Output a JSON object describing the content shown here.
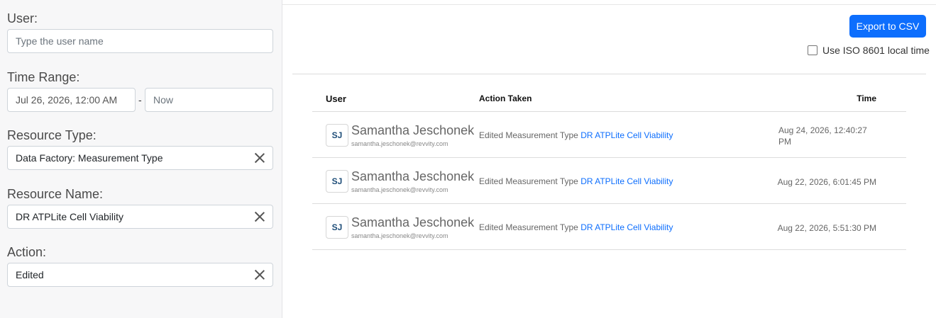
{
  "filters": {
    "user": {
      "label": "User:",
      "placeholder": "Type the user name"
    },
    "time_range": {
      "label": "Time Range:",
      "start": "Jul 26, 2026, 12:00 AM",
      "separator": "-",
      "end_placeholder": "Now"
    },
    "resource_type": {
      "label": "Resource Type:",
      "value": "Data Factory: Measurement Type"
    },
    "resource_name": {
      "label": "Resource Name:",
      "value": "DR ATPLite Cell Viability"
    },
    "action": {
      "label": "Action:",
      "value": "Edited"
    }
  },
  "toolbar": {
    "export_label": "Export to CSV",
    "iso_label": "Use ISO 8601 local time"
  },
  "table": {
    "columns": {
      "user": "User",
      "action": "Action Taken",
      "time": "Time"
    },
    "rows": [
      {
        "initials": "SJ",
        "name": "Samantha Jeschonek",
        "email": "samantha.jeschonek@revvity.com",
        "action_text": "Edited Measurement Type ",
        "action_link": "DR ATPLite Cell Viability",
        "time": "Aug 24, 2026, 12:40:27 PM"
      },
      {
        "initials": "SJ",
        "name": "Samantha Jeschonek",
        "email": "samantha.jeschonek@revvity.com",
        "action_text": "Edited Measurement Type ",
        "action_link": "DR ATPLite Cell Viability",
        "time": "Aug 22, 2026, 6:01:45 PM"
      },
      {
        "initials": "SJ",
        "name": "Samantha Jeschonek",
        "email": "samantha.jeschonek@revvity.com",
        "action_text": "Edited Measurement Type ",
        "action_link": "DR ATPLite Cell Viability",
        "time": "Aug 22, 2026, 5:51:30 PM"
      }
    ]
  },
  "colors": {
    "primary": "#0d6efd",
    "sidebar_bg": "#f7f7f8"
  }
}
